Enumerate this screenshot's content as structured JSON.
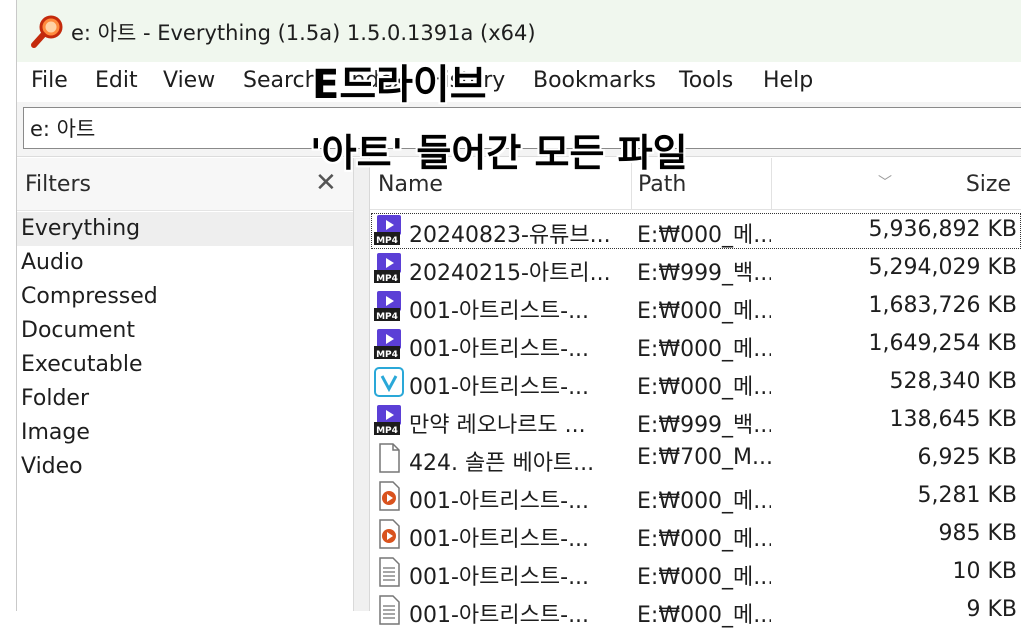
{
  "window": {
    "title": "e: 아트 - Everything (1.5a) 1.5.0.1391a (x64)"
  },
  "menu": [
    "File",
    "Edit",
    "View",
    "Search",
    "Index",
    "History",
    "Bookmarks",
    "Tools",
    "Help"
  ],
  "search": {
    "value": "e: 아트"
  },
  "filters": {
    "title": "Filters",
    "close_glyph": "✕",
    "items": [
      "Everything",
      "Audio",
      "Compressed",
      "Document",
      "Executable",
      "Folder",
      "Image",
      "Video"
    ],
    "selected": "Everything"
  },
  "columns": {
    "name": "Name",
    "path": "Path",
    "size": "Size"
  },
  "rows": [
    {
      "icon": "mp4-video-icon",
      "name": "20240823-유튜브...",
      "path": "E:₩000_메...",
      "size": "5,936,892 KB",
      "extra": "2"
    },
    {
      "icon": "mp4-video-icon",
      "name": "20240215-아트리...",
      "path": "E:₩999_백...",
      "size": "5,294,029 KB",
      "extra": "2"
    },
    {
      "icon": "mp4-video-icon",
      "name": "001-아트리스트-...",
      "path": "E:₩000_메...",
      "size": "1,683,726 KB",
      "extra": "2"
    },
    {
      "icon": "mp4-video-icon",
      "name": "001-아트리스트-...",
      "path": "E:₩000_메...",
      "size": "1,649,254 KB",
      "extra": "2"
    },
    {
      "icon": "vrew-icon",
      "name": "001-아트리스트-...",
      "path": "E:₩000_메...",
      "size": "528,340 KB",
      "extra": "2"
    },
    {
      "icon": "mp4-video-icon",
      "name": "만약 레오나르도 ...",
      "path": "E:₩999_백...",
      "size": "138,645 KB",
      "extra": "2"
    },
    {
      "icon": "blank-file-icon",
      "name": "424. 솔픈 베아트...",
      "path": "E:₩700_M...",
      "size": "6,925 KB",
      "extra": "2"
    },
    {
      "icon": "media-file-icon",
      "name": "001-아트리스트-...",
      "path": "E:₩000_메...",
      "size": "5,281 KB",
      "extra": "2"
    },
    {
      "icon": "media-file-icon",
      "name": "001-아트리스트-...",
      "path": "E:₩000_메...",
      "size": "985 KB",
      "extra": "2"
    },
    {
      "icon": "text-file-icon",
      "name": "001-아트리스트-...",
      "path": "E:₩000_메...",
      "size": "10 KB",
      "extra": "2"
    },
    {
      "icon": "text-file-icon",
      "name": "001-아트리스트-...",
      "path": "E:₩000_메...",
      "size": "9 KB",
      "extra": "2"
    }
  ],
  "overlay": {
    "line1": "E드라이브",
    "line2": "'아트' 들어간 모든 파일"
  },
  "colors": {
    "titlebar_bg": "#f0f7ee",
    "mp4_icon": "#5b3fd6",
    "vrew_icon": "#2aa8d8"
  }
}
